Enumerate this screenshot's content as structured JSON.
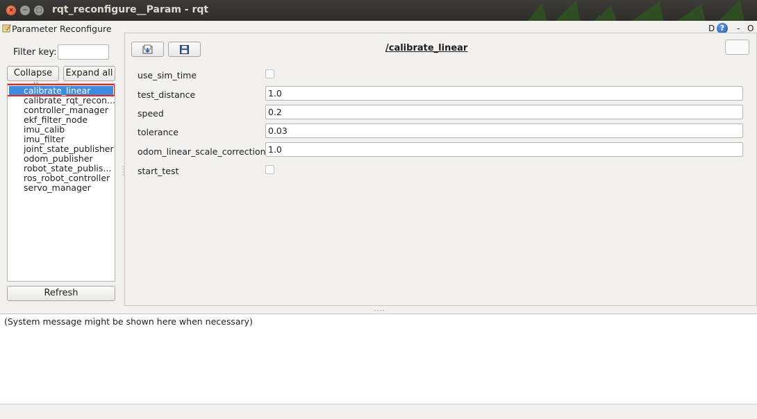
{
  "window": {
    "title": "rqt_reconfigure__Param - rqt",
    "close_glyph": "×",
    "min_glyph": "−",
    "max_glyph": "□"
  },
  "plugin": {
    "title": "Parameter Reconfigure",
    "icon": "notepad-pencil-icon",
    "header_d": "D",
    "header_help": "?",
    "header_dash": "-",
    "header_o": "O"
  },
  "left_panel": {
    "filter_label": "Filter key:",
    "filter_value": "",
    "collapse_label": "Collapse all",
    "expand_label": "Expand all",
    "refresh_label": "Refresh",
    "nodes": [
      "calibrate_linear",
      "calibrate_rqt_recon...",
      "controller_manager",
      "ekf_filter_node",
      "imu_calib",
      "imu_filter",
      "joint_state_publisher",
      "odom_publisher",
      "robot_state_publis...",
      "ros_robot_controller",
      "servo_manager"
    ],
    "selected_node": "calibrate_linear"
  },
  "right_panel": {
    "node_title": "/calibrate_linear",
    "load_icon": "load-file-icon",
    "save_icon": "save-disk-icon",
    "params": [
      {
        "name": "use_sim_time",
        "type": "bool",
        "value": false
      },
      {
        "name": "test_distance",
        "type": "text",
        "value": "1.0"
      },
      {
        "name": "speed",
        "type": "text",
        "value": "0.2"
      },
      {
        "name": "tolerance",
        "type": "text",
        "value": "0.03"
      },
      {
        "name": "odom_linear_scale_correction",
        "type": "text",
        "value": "1.0"
      },
      {
        "name": "start_test",
        "type": "bool",
        "value": false
      }
    ]
  },
  "console": {
    "message": "(System message might be shown here when necessary)"
  },
  "colors": {
    "selection": "#3d8ce0",
    "highlight_border": "#e8261b",
    "titlebar": "#3c3b37"
  }
}
